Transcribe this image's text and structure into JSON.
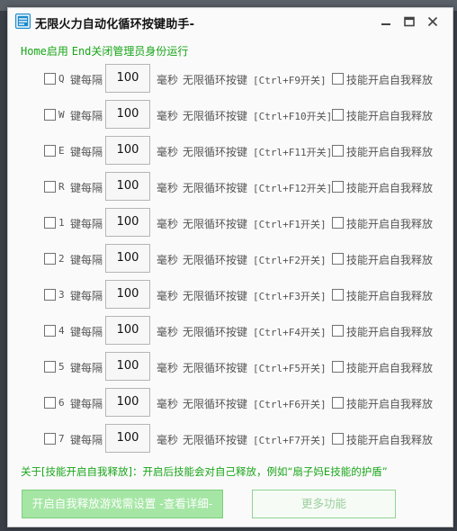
{
  "window": {
    "title": "无限火力自动化循环按键助手-",
    "hint_home": "Home",
    "hint_enable": "启用 ",
    "hint_end": "End",
    "hint_rest": "关闭管理员身份运行"
  },
  "rows_common": {
    "interval_label": "键每隔",
    "ms_label": "毫秒",
    "loop_label": "无限循环按键",
    "self_release_label": "技能开启自我释放"
  },
  "rows": [
    {
      "key": "Q",
      "interval": "100",
      "hotkey": "[Ctrl+F9开关]"
    },
    {
      "key": "W",
      "interval": "100",
      "hotkey": "[Ctrl+F10开关]"
    },
    {
      "key": "E",
      "interval": "100",
      "hotkey": "[Ctrl+F11开关]"
    },
    {
      "key": "R",
      "interval": "100",
      "hotkey": "[Ctrl+F12开关]"
    },
    {
      "key": "1",
      "interval": "100",
      "hotkey": "[Ctrl+F1开关]"
    },
    {
      "key": "2",
      "interval": "100",
      "hotkey": "[Ctrl+F2开关]"
    },
    {
      "key": "3",
      "interval": "100",
      "hotkey": "[Ctrl+F3开关]"
    },
    {
      "key": "4",
      "interval": "100",
      "hotkey": "[Ctrl+F4开关]"
    },
    {
      "key": "5",
      "interval": "100",
      "hotkey": "[Ctrl+F5开关]"
    },
    {
      "key": "6",
      "interval": "100",
      "hotkey": "[Ctrl+F6开关]"
    },
    {
      "key": "7",
      "interval": "100",
      "hotkey": "[Ctrl+F7开关]"
    }
  ],
  "note": "关于[技能开启自我释放]：开启后技能会对自己释放，例如“扇子妈E技能的护盾”",
  "buttons": {
    "self_release": "开启自我释放游戏需设置 -查看详细-",
    "more": "更多功能"
  },
  "colors": {
    "accent_green": "#19a619",
    "button_green": "#a5e6a5"
  }
}
